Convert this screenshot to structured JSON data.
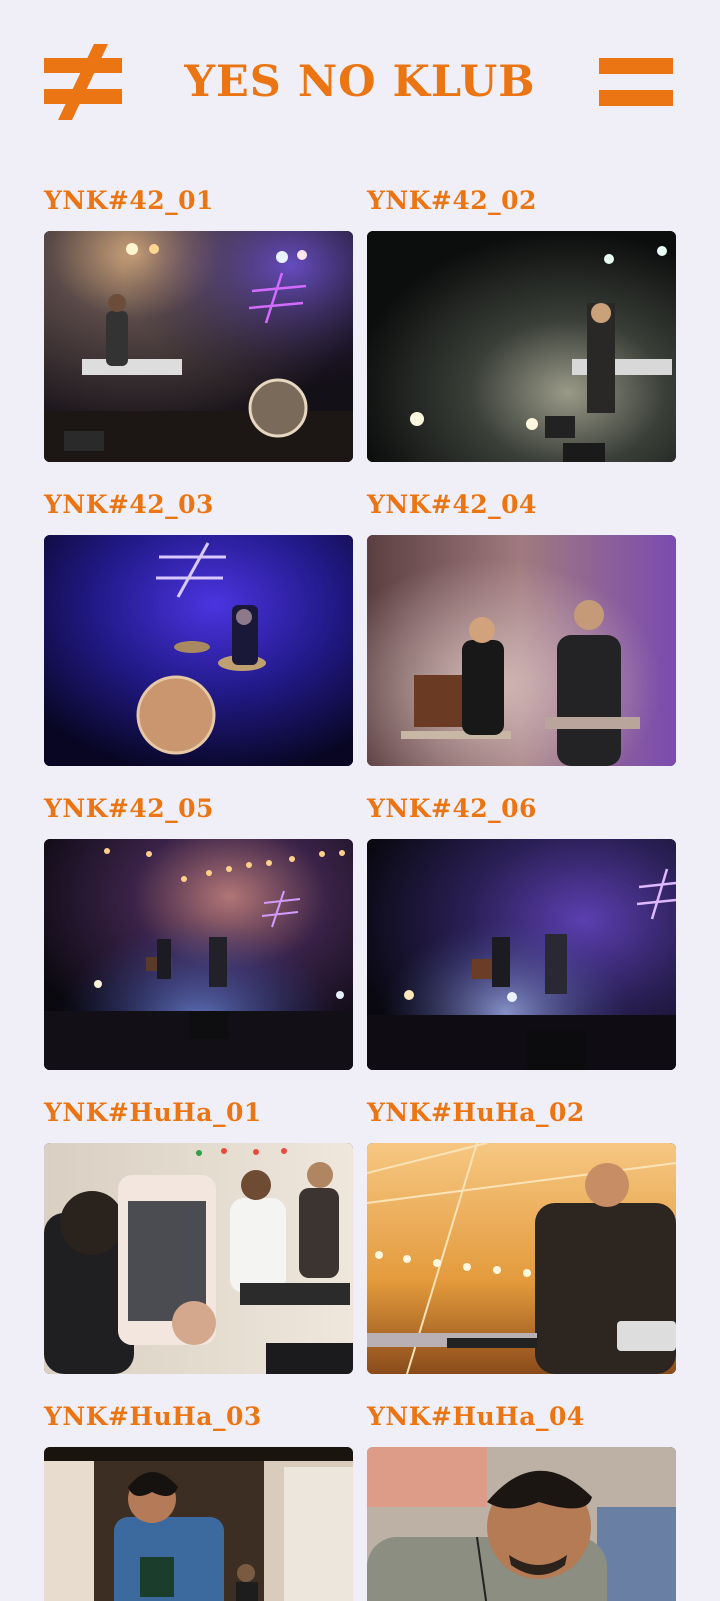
{
  "header": {
    "logo_icon": "not-equal-icon",
    "title": "YES NO KLUB",
    "menu_icon": "equals-menu-icon"
  },
  "colors": {
    "accent": "#ea7512",
    "background": "#f0eff8"
  },
  "gallery": {
    "items": [
      {
        "label": "YNK#42_01"
      },
      {
        "label": "YNK#42_02"
      },
      {
        "label": "YNK#42_03"
      },
      {
        "label": "YNK#42_04"
      },
      {
        "label": "YNK#42_05"
      },
      {
        "label": "YNK#42_06"
      },
      {
        "label": "YNK#HuHa_01"
      },
      {
        "label": "YNK#HuHa_02"
      },
      {
        "label": "YNK#HuHa_03"
      },
      {
        "label": "YNK#HuHa_04"
      }
    ]
  }
}
